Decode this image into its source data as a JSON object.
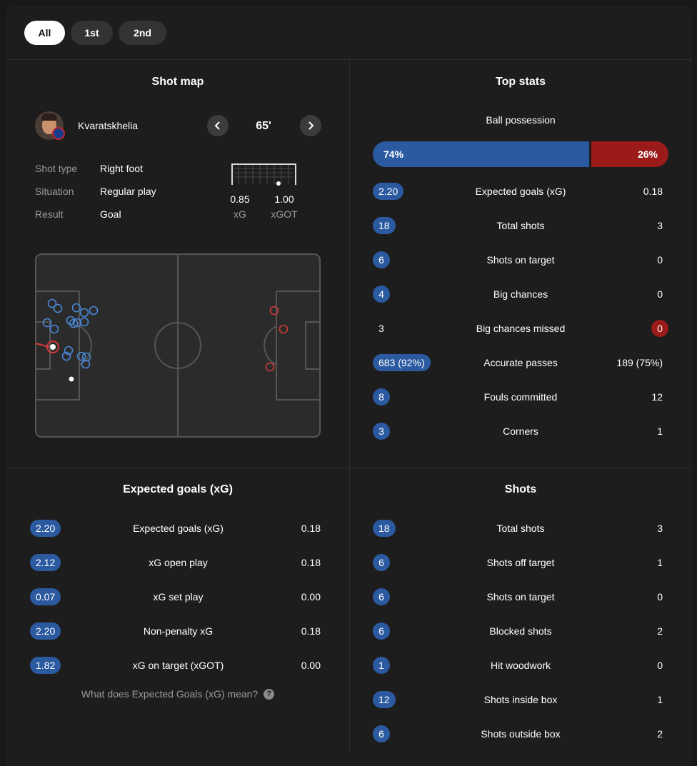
{
  "tabs": [
    "All",
    "1st",
    "2nd"
  ],
  "shot_map": {
    "title": "Shot map",
    "player": "Kvaratskhelia",
    "minute": "65'",
    "details": [
      {
        "label": "Shot type",
        "value": "Right foot"
      },
      {
        "label": "Situation",
        "value": "Regular play"
      },
      {
        "label": "Result",
        "value": "Goal"
      }
    ],
    "xg": {
      "value": "0.85",
      "label": "xG"
    },
    "xgot": {
      "value": "1.00",
      "label": "xGOT"
    }
  },
  "top_stats": {
    "title": "Top stats",
    "possession_label": "Ball possession",
    "possession_home": "74%",
    "possession_away": "26%",
    "possession_home_fraction": 0.74,
    "rows": [
      {
        "home": "2.20",
        "label": "Expected goals (xG)",
        "away": "0.18",
        "home_style": "pill",
        "away_style": "plain"
      },
      {
        "home": "18",
        "label": "Total shots",
        "away": "3",
        "home_style": "pill",
        "away_style": "plain"
      },
      {
        "home": "6",
        "label": "Shots on target",
        "away": "0",
        "home_style": "pill",
        "away_style": "plain"
      },
      {
        "home": "4",
        "label": "Big chances",
        "away": "0",
        "home_style": "pill",
        "away_style": "plain"
      },
      {
        "home": "3",
        "label": "Big chances missed",
        "away": "0",
        "home_style": "plain",
        "away_style": "pill-red"
      },
      {
        "home": "683 (92%)",
        "label": "Accurate passes",
        "away": "189 (75%)",
        "home_style": "pill",
        "away_style": "plain"
      },
      {
        "home": "8",
        "label": "Fouls committed",
        "away": "12",
        "home_style": "pill",
        "away_style": "plain"
      },
      {
        "home": "3",
        "label": "Corners",
        "away": "1",
        "home_style": "pill",
        "away_style": "plain"
      }
    ]
  },
  "xg_section": {
    "title": "Expected goals (xG)",
    "rows": [
      {
        "home": "2.20",
        "label": "Expected goals (xG)",
        "away": "0.18"
      },
      {
        "home": "2.12",
        "label": "xG open play",
        "away": "0.18"
      },
      {
        "home": "0.07",
        "label": "xG set play",
        "away": "0.00"
      },
      {
        "home": "2.20",
        "label": "Non-penalty xG",
        "away": "0.18"
      },
      {
        "home": "1.82",
        "label": "xG on target (xGOT)",
        "away": "0.00"
      }
    ],
    "help_text": "What does Expected Goals (xG) mean?",
    "help_icon": "?"
  },
  "shots_section": {
    "title": "Shots",
    "rows": [
      {
        "home": "18",
        "label": "Total shots",
        "away": "3"
      },
      {
        "home": "6",
        "label": "Shots off target",
        "away": "1"
      },
      {
        "home": "6",
        "label": "Shots on target",
        "away": "0"
      },
      {
        "home": "6",
        "label": "Blocked shots",
        "away": "2"
      },
      {
        "home": "1",
        "label": "Hit woodwork",
        "away": "0"
      },
      {
        "home": "12",
        "label": "Shots inside box",
        "away": "1"
      },
      {
        "home": "6",
        "label": "Shots outside box",
        "away": "2"
      }
    ]
  },
  "colors": {
    "home": "#2c5aa0",
    "away": "#9b1b1b",
    "home_marker": "#4a86d6",
    "away_marker": "#d23a3a"
  }
}
